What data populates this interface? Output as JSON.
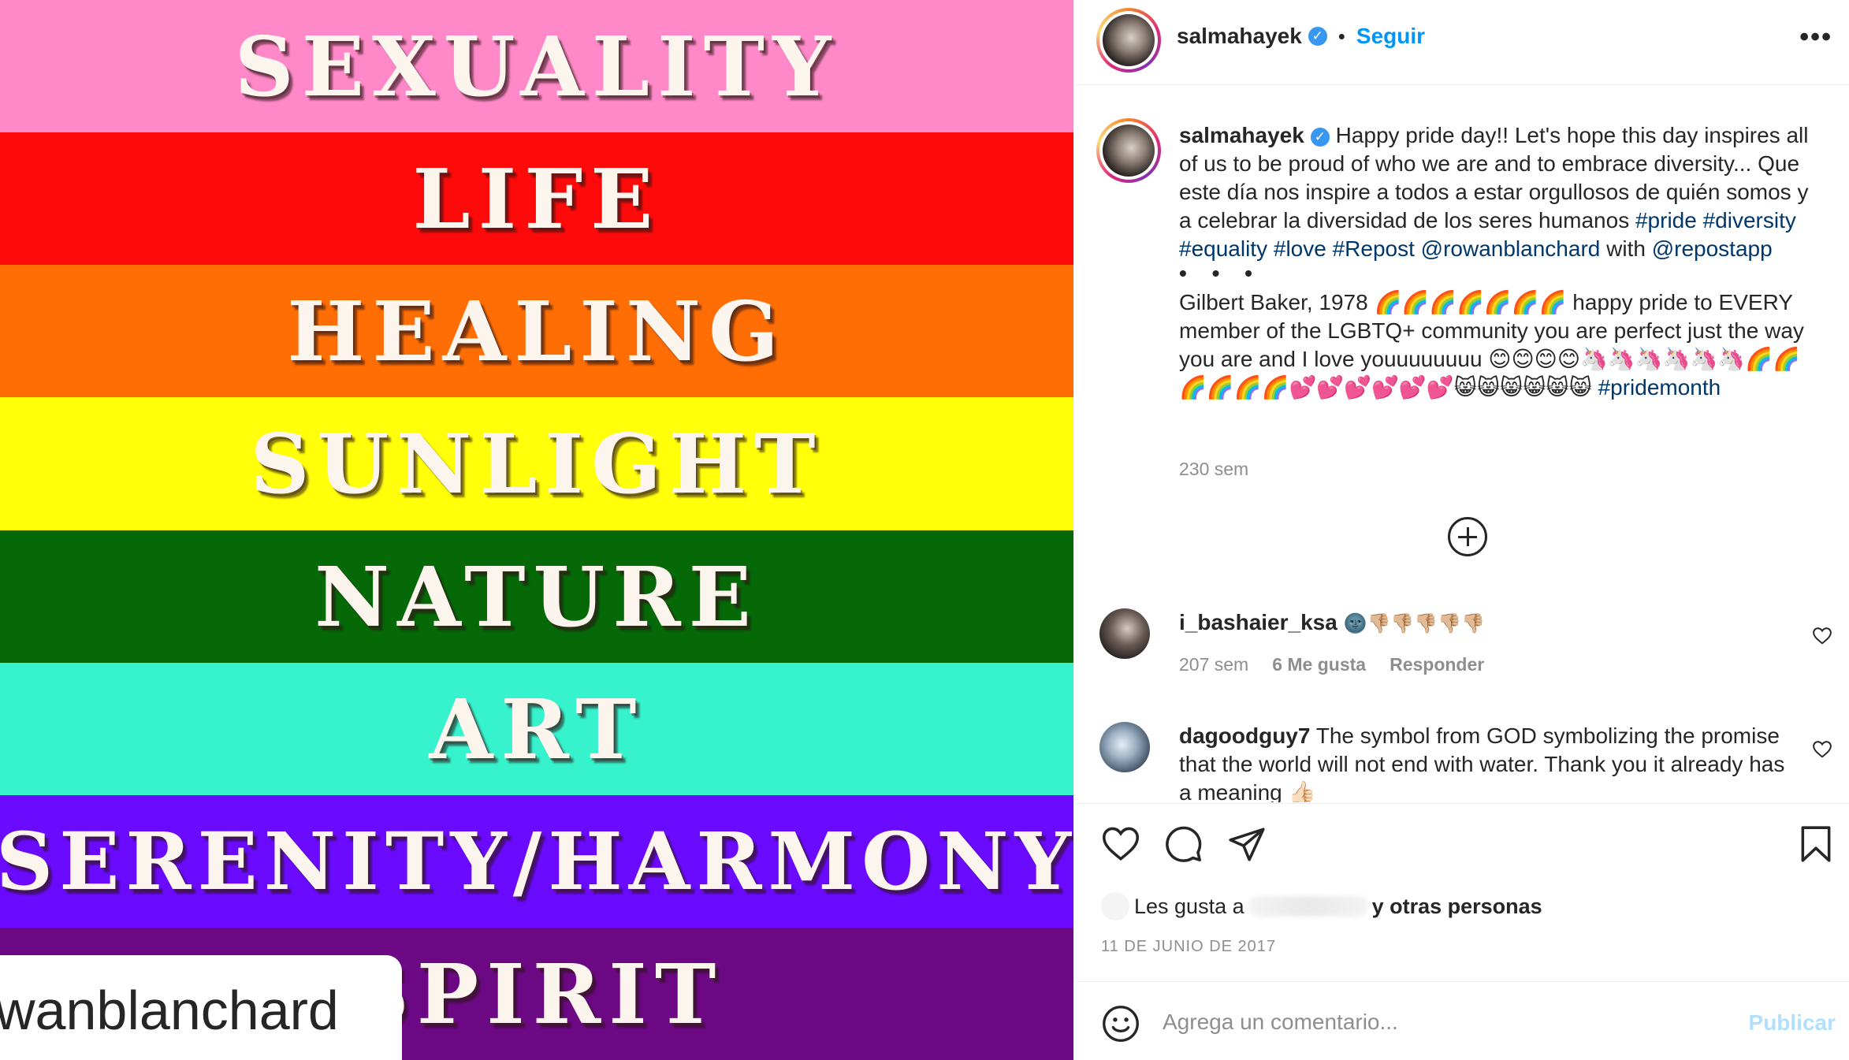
{
  "image": {
    "stripes": [
      {
        "word": "SEXUALITY",
        "color": "#ff88c8"
      },
      {
        "word": "LIFE",
        "color": "#ff0a0a"
      },
      {
        "word": "HEALING",
        "color": "#ff6d05"
      },
      {
        "word": "SUNLIGHT",
        "color": "#ffff0a"
      },
      {
        "word": "NATURE",
        "color": "#056908"
      },
      {
        "word": "ART",
        "color": "#36f2cd"
      },
      {
        "word": "SERENITY/HARMONY",
        "color": "#6a0aff"
      },
      {
        "word": "SPIRIT",
        "color": "#6c0884"
      }
    ],
    "tag_text": "wanblanchard"
  },
  "header": {
    "username": "salmahayek",
    "verified_mark": "✓",
    "dot": "•",
    "follow_label": "Seguir",
    "more_label": "•••"
  },
  "caption": {
    "username": "salmahayek",
    "text_1": "Happy pride day!! Let's hope this day inspires all of us to be proud of who we are and to embrace diversity... Que este día nos inspire a todos a estar orgullosos de quién somos y a celebrar la diversidad de los seres humanos",
    "tags_1": [
      "#pride",
      "#diversity",
      "#equality",
      "#love",
      "#Repost"
    ],
    "mention_1": "@rowanblanchard",
    "with_word": "with",
    "mention_2": "@repostapp",
    "dots": "• • •",
    "text_2": "Gilbert Baker, 1978 🌈🌈🌈🌈🌈🌈🌈 happy pride to EVERY member of the LGBTQ+ community you are perfect just the way you are and I love youuuuuuuu 😊😊😊😊🦄🦄🦄🦄🦄🦄🌈🌈🌈🌈🌈🌈💕💕💕💕💕💕😸😸😸😸😸😸",
    "tag_2": "#pridemonth",
    "time": "230 sem"
  },
  "comments": [
    {
      "username": "i_bashaier_ksa",
      "text": "🌚👎🏼👎🏼👎🏼👎🏼👎🏼",
      "time": "207 sem",
      "likes": "6 Me gusta",
      "reply": "Responder"
    },
    {
      "username": "dagoodguy7",
      "text": "The symbol from GOD symbolizing the promise that the world will not end with water. Thank you it already has a meaning 👍🏻",
      "time": "",
      "likes": "",
      "reply": ""
    }
  ],
  "actions": {
    "likes_prefix": "Les gusta a",
    "likes_suffix": "y otras personas",
    "date": "11 DE JUNIO DE 2017"
  },
  "add_comment": {
    "placeholder": "Agrega un comentario...",
    "publish_label": "Publicar"
  },
  "colors": {
    "link": "#00376b",
    "accent": "#0095f6",
    "publish_disabled": "#b2dffc",
    "muted": "#8e8e8e"
  }
}
